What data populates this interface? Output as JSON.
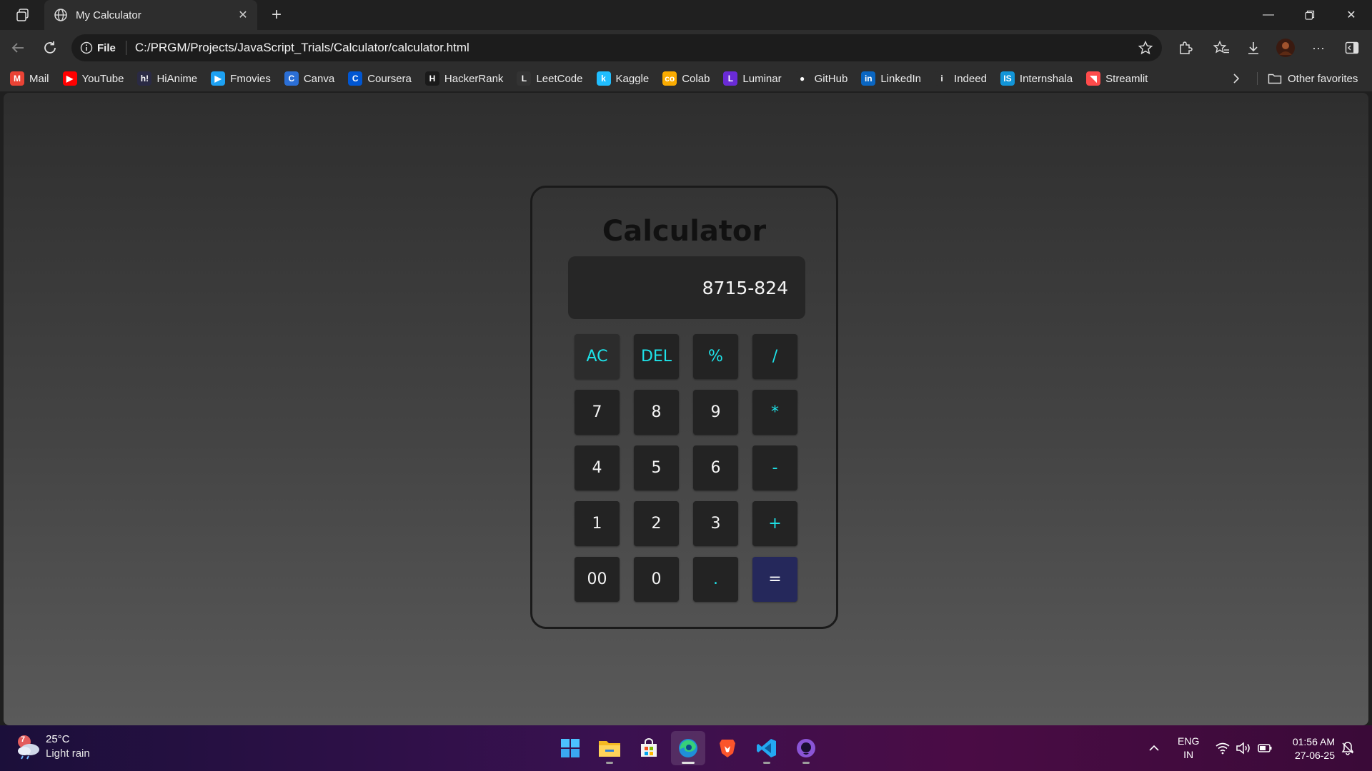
{
  "browser": {
    "tab_title": "My Calculator",
    "address": {
      "scheme_label": "File",
      "url": "C:/PRGM/Projects/JavaScript_Trials/Calculator/calculator.html"
    },
    "bookmarks": [
      {
        "label": "Mail",
        "icon": "gmail-icon",
        "color": "#ea4335",
        "glyph": "M"
      },
      {
        "label": "YouTube",
        "icon": "youtube-icon",
        "color": "#ff0000",
        "glyph": "▶"
      },
      {
        "label": "HiAnime",
        "icon": "hianime-icon",
        "color": "#2a2a44",
        "glyph": "h!"
      },
      {
        "label": "Fmovies",
        "icon": "fmovies-icon",
        "color": "#1da1f2",
        "glyph": "▶"
      },
      {
        "label": "Canva",
        "icon": "canva-icon",
        "color": "#2b6fd6",
        "glyph": "C"
      },
      {
        "label": "Coursera",
        "icon": "coursera-icon",
        "color": "#0056d2",
        "glyph": "C"
      },
      {
        "label": "HackerRank",
        "icon": "hackerrank-icon",
        "color": "#1a1a1a",
        "glyph": "H"
      },
      {
        "label": "LeetCode",
        "icon": "leetcode-icon",
        "color": "#333333",
        "glyph": "L"
      },
      {
        "label": "Kaggle",
        "icon": "kaggle-icon",
        "color": "#20beff",
        "glyph": "k"
      },
      {
        "label": "Colab",
        "icon": "colab-icon",
        "color": "#f9ab00",
        "glyph": "co"
      },
      {
        "label": "Luminar",
        "icon": "luminar-icon",
        "color": "#6a2bd6",
        "glyph": "L"
      },
      {
        "label": "GitHub",
        "icon": "github-icon",
        "color": "#2d2d2d",
        "glyph": "●"
      },
      {
        "label": "LinkedIn",
        "icon": "linkedin-icon",
        "color": "#0a66c2",
        "glyph": "in"
      },
      {
        "label": "Indeed",
        "icon": "indeed-icon",
        "color": "#2d2d2d",
        "glyph": "i"
      },
      {
        "label": "Internshala",
        "icon": "internshala-icon",
        "color": "#1295d8",
        "glyph": "IS"
      },
      {
        "label": "Streamlit",
        "icon": "streamlit-icon",
        "color": "#ff4b4b",
        "glyph": "◥"
      }
    ],
    "other_favorites": "Other favorites"
  },
  "calculator": {
    "title": "Calculator",
    "display": "8715-824",
    "keys": [
      {
        "label": "AC",
        "name": "key-ac",
        "kind": "op ac"
      },
      {
        "label": "DEL",
        "name": "key-del",
        "kind": "op"
      },
      {
        "label": "%",
        "name": "key-percent",
        "kind": "op"
      },
      {
        "label": "/",
        "name": "key-divide",
        "kind": "op"
      },
      {
        "label": "7",
        "name": "key-7",
        "kind": ""
      },
      {
        "label": "8",
        "name": "key-8",
        "kind": ""
      },
      {
        "label": "9",
        "name": "key-9",
        "kind": ""
      },
      {
        "label": "*",
        "name": "key-multiply",
        "kind": "op"
      },
      {
        "label": "4",
        "name": "key-4",
        "kind": ""
      },
      {
        "label": "5",
        "name": "key-5",
        "kind": ""
      },
      {
        "label": "6",
        "name": "key-6",
        "kind": ""
      },
      {
        "label": "-",
        "name": "key-minus",
        "kind": "op"
      },
      {
        "label": "1",
        "name": "key-1",
        "kind": ""
      },
      {
        "label": "2",
        "name": "key-2",
        "kind": ""
      },
      {
        "label": "3",
        "name": "key-3",
        "kind": ""
      },
      {
        "label": "+",
        "name": "key-plus",
        "kind": "op"
      },
      {
        "label": "00",
        "name": "key-00",
        "kind": ""
      },
      {
        "label": "0",
        "name": "key-0",
        "kind": ""
      },
      {
        "label": ".",
        "name": "key-decimal",
        "kind": "op"
      },
      {
        "label": "=",
        "name": "key-equals",
        "kind": "eq"
      }
    ],
    "colors": {
      "accent": "#1ee3e9",
      "equals_bg": "#25285b",
      "key_bg": "#232323"
    }
  },
  "taskbar": {
    "weather": {
      "temp": "25°C",
      "condition": "Light rain",
      "badge": "7"
    },
    "apps": [
      {
        "name": "taskbar-start",
        "icon": "windows-start-icon"
      },
      {
        "name": "taskbar-file-explorer",
        "icon": "folder-icon"
      },
      {
        "name": "taskbar-store",
        "icon": "store-icon"
      },
      {
        "name": "taskbar-edge",
        "icon": "edge-icon"
      },
      {
        "name": "taskbar-brave",
        "icon": "brave-icon"
      },
      {
        "name": "taskbar-vscode",
        "icon": "vscode-icon"
      },
      {
        "name": "taskbar-github-desktop",
        "icon": "github-desktop-icon"
      }
    ],
    "language": {
      "line1": "ENG",
      "line2": "IN"
    },
    "time": "01:56 AM",
    "date": "27-06-25"
  }
}
